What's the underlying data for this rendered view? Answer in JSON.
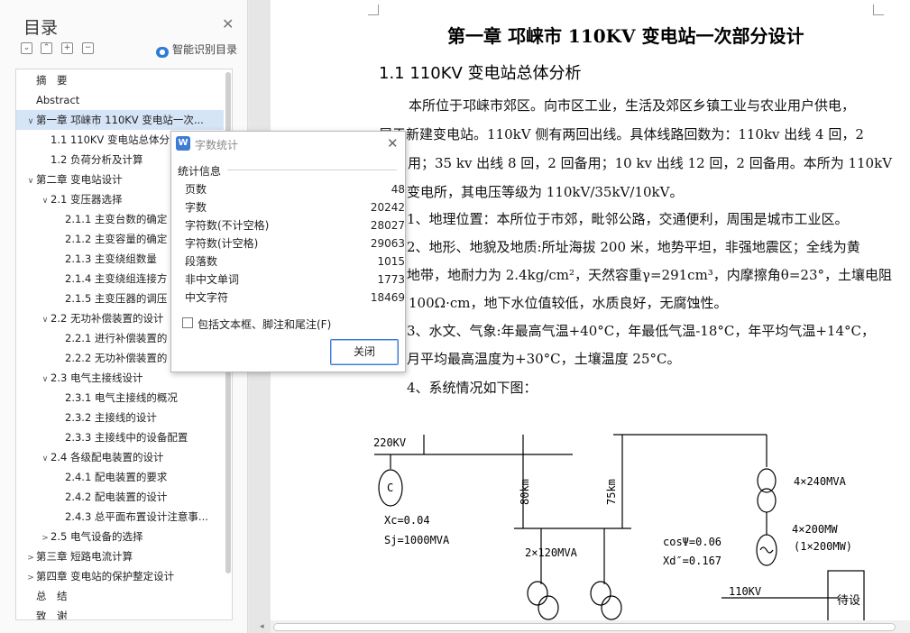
{
  "toc": {
    "title": "目录",
    "smart_label": "智能识别目录",
    "items": [
      {
        "label": "摘　要",
        "level": 0,
        "arrow": ""
      },
      {
        "label": "Abstract",
        "level": 0,
        "arrow": ""
      },
      {
        "label": "第一章  邛崃市 110KV 变电站一次...",
        "level": 0,
        "arrow": "v",
        "selected": true
      },
      {
        "label": "1.1 110KV 变电站总体分",
        "level": 1,
        "arrow": ""
      },
      {
        "label": "1.2 负荷分析及计算",
        "level": 1,
        "arrow": ""
      },
      {
        "label": "第二章  变电站设计",
        "level": 0,
        "arrow": "v"
      },
      {
        "label": "2.1 变压器选择",
        "level": 1,
        "arrow": "v"
      },
      {
        "label": "2.1.1 主变台数的确定",
        "level": 2,
        "arrow": ""
      },
      {
        "label": "2.1.2 主变容量的确定",
        "level": 2,
        "arrow": ""
      },
      {
        "label": "2.1.3 主变绕组数量",
        "level": 2,
        "arrow": ""
      },
      {
        "label": "2.1.4 主变绕组连接方",
        "level": 2,
        "arrow": ""
      },
      {
        "label": "2.1.5 主变压器的调压",
        "level": 2,
        "arrow": ""
      },
      {
        "label": "2.2  无功补偿装置的设计",
        "level": 1,
        "arrow": "v"
      },
      {
        "label": "2.2.1 进行补偿装置的",
        "level": 2,
        "arrow": ""
      },
      {
        "label": "2.2.2 无功补偿装置的",
        "level": 2,
        "arrow": ""
      },
      {
        "label": "2.3  电气主接线设计",
        "level": 1,
        "arrow": "v"
      },
      {
        "label": "2.3.1 电气主接线的概况",
        "level": 2,
        "arrow": ""
      },
      {
        "label": "2.3.2 主接线的设计",
        "level": 2,
        "arrow": ""
      },
      {
        "label": "2.3.3 主接线中的设备配置",
        "level": 2,
        "arrow": ""
      },
      {
        "label": "2.4  各级配电装置的设计",
        "level": 1,
        "arrow": "v"
      },
      {
        "label": "2.4.1 配电装置的要求",
        "level": 2,
        "arrow": ""
      },
      {
        "label": "2.4.2 配电装置的设计",
        "level": 2,
        "arrow": ""
      },
      {
        "label": "2.4.3 总平面布置设计注意事...",
        "level": 2,
        "arrow": ""
      },
      {
        "label": "2.5  电气设备的选择",
        "level": 1,
        "arrow": ">"
      },
      {
        "label": "第三章  短路电流计算",
        "level": 0,
        "arrow": ">"
      },
      {
        "label": "第四章  变电站的保护整定设计",
        "level": 0,
        "arrow": ">"
      },
      {
        "label": "总　结",
        "level": 0,
        "arrow": ""
      },
      {
        "label": "致　谢",
        "level": 0,
        "arrow": ""
      }
    ]
  },
  "doc": {
    "chapter_title": "第一章  邛崃市 110KV 变电站一次部分设计",
    "section_title": "1.1 110KV 变电站总体分析",
    "paragraphs": [
      "本所位于邛崃市郊区。向市区工业，生活及郊区乡镇工业与农业用户供电，",
      "属于新建变电站。110kV 侧有两回出线。具体线路回数为：110kv 出线 4 回，2",
      "用；35 kv 出线 8 回，2 回备用；10 kv 出线 12 回，2 回备用。本所为 110kV",
      "变电所，其电压等级为 110kV/35kV/10kV。",
      "1、地理位置：本所位于市郊，毗邻公路，交通便利，周围是城市工业区。",
      "2、地形、地貌及地质:所址海拔 200 米，地势平坦，非强地震区；全线为黄",
      "地带，地耐力为 2.4kg/cm²，天然容重γ=291cm³，内摩擦角θ=23°，土壤电阻",
      "100Ω·cm，地下水位值较低，水质良好，无腐蚀性。",
      "3、水文、气象:年最高气温+40°C，年最低气温-18°C，年平均气温+14°C，",
      "月平均最高温度为+30°C，土壤温度 25°C。",
      "4、系统情况如下图："
    ],
    "diagram": {
      "bus_220": "220KV",
      "source_c": "C",
      "xc": "Xc=0.04",
      "sj": "Sj=1000MVA",
      "line_80": "80km",
      "line_75": "75km",
      "trans_2x120": "2×120MVA",
      "gen_4x240": "4×240MVA",
      "gen_4x200": "4×200MW",
      "gen_1x200": "(1×200MW)",
      "cos": "cosΨ=0.06",
      "xd": "Xd″=0.167",
      "bus_110": "110KV",
      "box_label": "待设"
    }
  },
  "dialog": {
    "title": "字数统计",
    "group_label": "统计信息",
    "stats": [
      {
        "label": "页数",
        "value": "48"
      },
      {
        "label": "字数",
        "value": "20242"
      },
      {
        "label": "字符数(不计空格)",
        "value": "28027"
      },
      {
        "label": "字符数(计空格)",
        "value": "29063"
      },
      {
        "label": "段落数",
        "value": "1015"
      },
      {
        "label": "非中文单词",
        "value": "1773"
      },
      {
        "label": "中文字符",
        "value": "18469"
      }
    ],
    "checkbox_label": "包括文本框、脚注和尾注(F)",
    "close_button": "关闭"
  }
}
